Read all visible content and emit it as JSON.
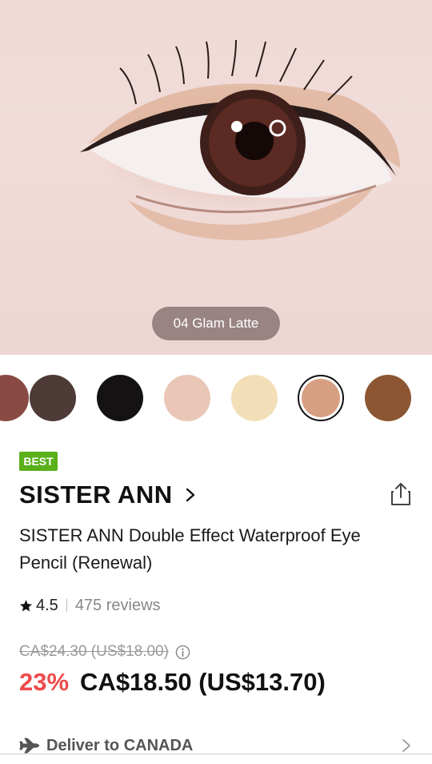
{
  "hero": {
    "image_alt": "close-up eye makeup photo",
    "shade_label": "04 Glam Latte"
  },
  "swatches": [
    {
      "name": "shade-partial",
      "color": "#8a4a44",
      "selected": false
    },
    {
      "name": "shade-dark-brown",
      "color": "#4e3a36",
      "selected": false
    },
    {
      "name": "shade-black",
      "color": "#141212",
      "selected": false
    },
    {
      "name": "shade-pink-beige",
      "color": "#e9c6b6",
      "selected": false
    },
    {
      "name": "shade-cream-gold",
      "color": "#f2dfb8",
      "selected": false
    },
    {
      "name": "shade-glam-latte",
      "color": "#d79f82",
      "selected": true
    },
    {
      "name": "shade-bronze",
      "color": "#8c5632",
      "selected": false
    }
  ],
  "badge": "BEST",
  "brand": "SISTER ANN",
  "product_title": "SISTER ANN Double Effect Waterproof Eye Pencil (Renewal)",
  "rating": {
    "value": "4.5",
    "reviews": "475 reviews"
  },
  "price": {
    "original": "CA$24.30 (US$18.00)",
    "discount": "23%",
    "current": "CA$18.50 (US$13.70)"
  },
  "delivery": {
    "label": "Deliver to CANADA"
  },
  "colors": {
    "badge": "#5ab01a",
    "discount": "#ef4b4b",
    "text": "#111111",
    "muted": "#888888"
  }
}
